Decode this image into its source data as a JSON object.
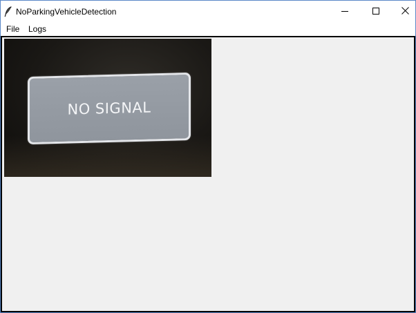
{
  "window": {
    "title": "NoParkingVehicleDetection",
    "app_icon": "feather-icon",
    "controls": {
      "minimize": "minimize-icon",
      "maximize": "maximize-icon",
      "close": "close-icon"
    }
  },
  "menubar": {
    "items": [
      {
        "label": "File"
      },
      {
        "label": "Logs"
      }
    ]
  },
  "video": {
    "overlay_text": "NO SIGNAL"
  },
  "colors": {
    "content_background": "#f0f0f0",
    "frame_border": "#000000",
    "signal_box": "#969ca4"
  }
}
